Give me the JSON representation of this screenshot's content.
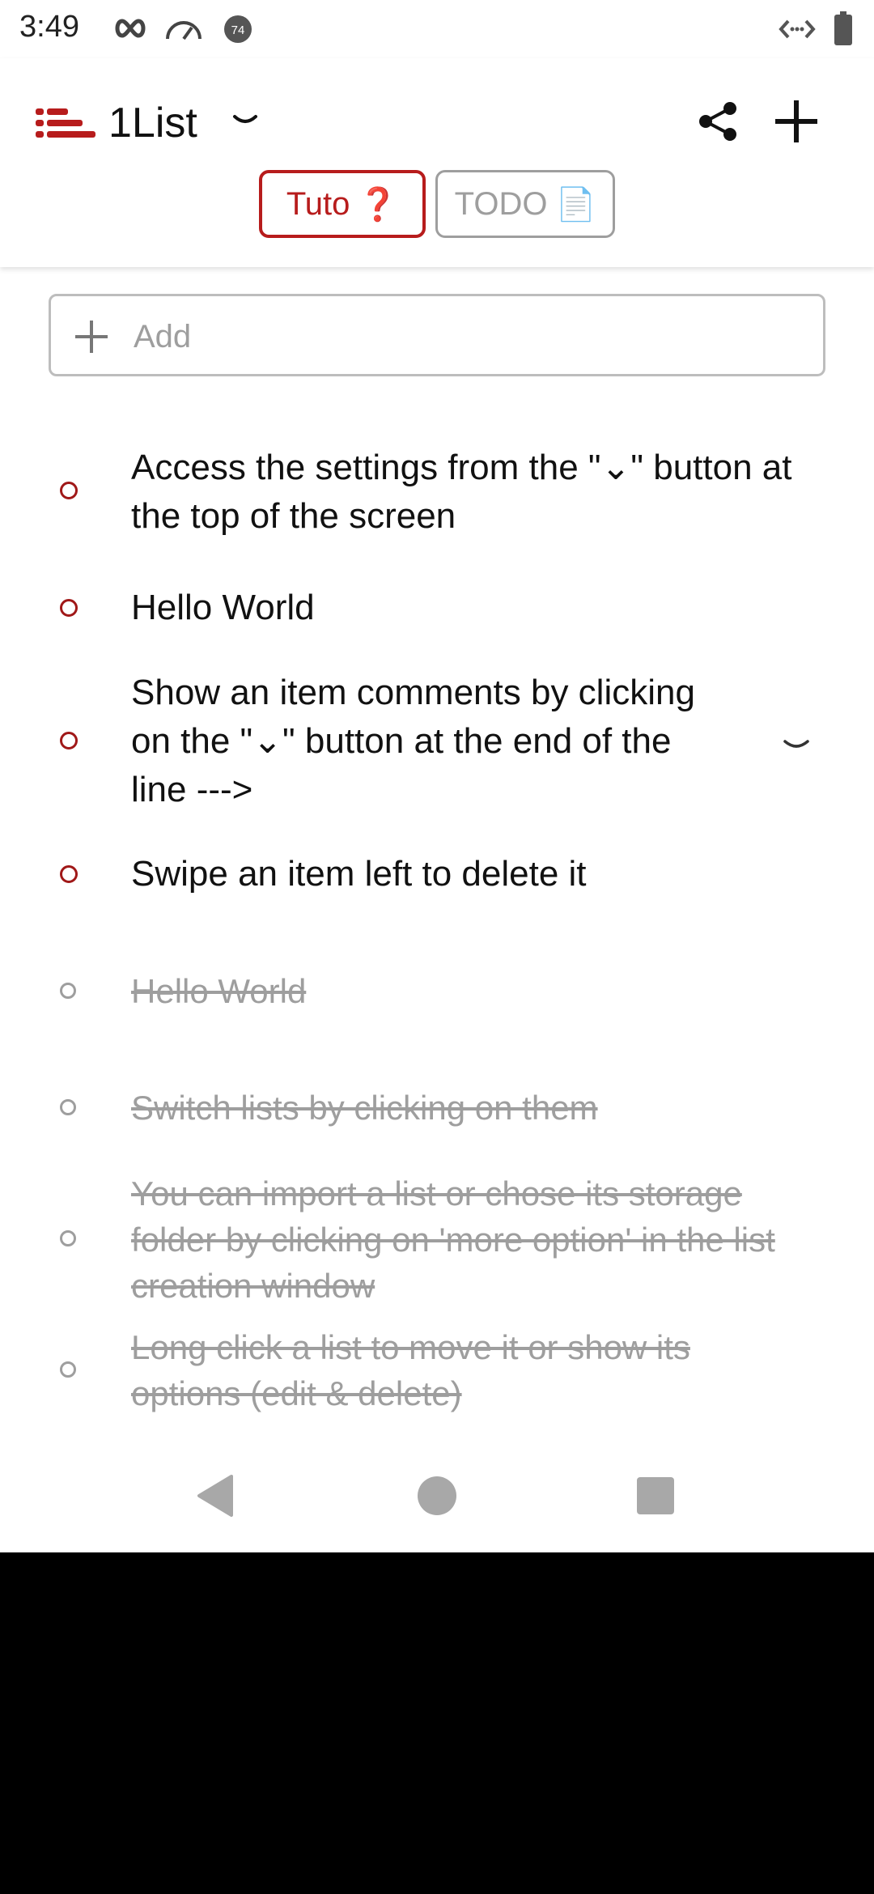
{
  "status_bar": {
    "time": "3:49",
    "icons": [
      "infinity-icon",
      "speed-icon",
      "notification-badge-icon",
      "code-icon",
      "battery-icon"
    ],
    "badge_text": "74"
  },
  "app_bar": {
    "title": "1List",
    "icons": {
      "logo": "list-logo-icon",
      "dropdown": "chevron-down-icon",
      "share": "share-icon",
      "add": "plus-icon"
    },
    "tabs": [
      {
        "label": "Tuto",
        "emoji": "❓",
        "active": true
      },
      {
        "label": "TODO",
        "emoji": "📄",
        "active": false
      }
    ]
  },
  "add_field": {
    "placeholder": "Add",
    "value": ""
  },
  "items": [
    {
      "text": "Access the settings from the \"⌄\" button at the top of the screen",
      "done": false
    },
    {
      "text": "Hello World",
      "done": false
    },
    {
      "text": "Show an item comments by clicking on the \"⌄\" button at the end of the line --->",
      "done": false,
      "has_comments": true
    },
    {
      "text": "Swipe an item left to delete it",
      "done": false
    },
    {
      "text": "Hello World",
      "done": true
    },
    {
      "text": "Switch lists by clicking on them",
      "done": true
    },
    {
      "text": "You can import a list or chose its storage folder by clicking on 'more option' in the list creation window",
      "done": true
    },
    {
      "text": "Long click a list to move it or show its options (edit & delete)",
      "done": true
    }
  ],
  "colors": {
    "accent": "#b71c1c",
    "done_text": "#9e9e9e",
    "text": "#111111",
    "nav": "#a8a8a8"
  },
  "nav_bar": {
    "icons": [
      "back-icon",
      "home-icon",
      "recents-icon"
    ]
  }
}
